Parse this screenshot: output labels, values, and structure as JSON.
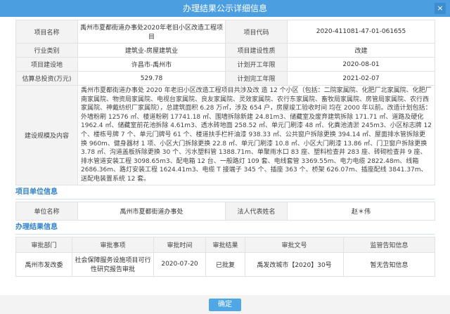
{
  "window": {
    "title": "办理结果公示详细信息",
    "close_glyph": "×"
  },
  "project": {
    "name_label": "项目名称",
    "name_value": "禹州市夏都街道办事处2020年老旧小区改造工程项目",
    "code_label": "项目代码",
    "code_value": "2020-411081-47-01-061655",
    "industry_label": "行业类别",
    "industry_value": "建筑业-房屋建筑业",
    "nature_label": "项目建设性质",
    "nature_value": "改建",
    "location_label": "项目建设地",
    "location_value": "许昌市-禹州市",
    "start_label": "计划开工年限",
    "start_value": "2020-08-01",
    "invest_label": "估算总投资(万元)",
    "invest_value": "529.78",
    "finish_label": "计划完工年限",
    "finish_value": "2021-02-07",
    "scope_label": "建设规模及内容",
    "scope_value": "禹州市夏都街道办事处 2020 年老旧小区改造工程项目共涉及改 造 12 个小区（包括：二院家属院、化肥厂北家属院、化肥厂南家属院、物资局家属院、电视台家属院、良友家属院、灵效家属院、农行东家属院、畜牧局家属院、房管局家属院、农行西家属院、神戴纺织厂家属院），总建筑面积 6.28 万㎡，涉及 654 户，房屋竣工验收时间 均在 2000 年以前。改造计划包括：外墙粉刷 12576 ㎡、楼道粉刷 17741.18 ㎡、围墙拆除新建 24.81m3、储藏室及废弃建筑拆除 171.71 ㎡、道路及硬化 1962.4 ㎡、储藏室前花池拆除 4.61m3、透水砖地面 258.52 ㎡、单元门刷漆 48 ㎡、化粪池清淤 245m3、小区标志牌 12 个、楼栋号牌 7 个、单元门牌号 61 个、楼道扶手栏杆油漆 938.33 ㎡、公共窗户拆除更换 394.14 ㎡、屋面排水管拆除更换 960m、健身器材 1 项、小区大门拆除更换 22.8 ㎡、单元门刷漆 10.8 ㎡、小区大门刷漆 13.86 ㎡、门卫窗户拆除更换 3.78 ㎡、沟道盖板拆除更换 30 个、污水塑料管 1388.71m、单聚雨水口 83 座、塑料检查井 283 座、砖砌检查井 9 座、排水管道安装工程 3098.65m3、配电箱 12 台、一般路灯 109 套、电线套管 3369.55m、电力电缆 2822.48m、线箱 2686.36m、路灯安装工程 1624.41m3、电缆 T 接端子 345 个、插座 363 个、桥架 626.07m、插座配线 3841.37m、送配电装置系统 12 套。"
  },
  "unit_section": {
    "title": "项目单位信息",
    "unit_label": "单位名称",
    "unit_value": "禹州市夏都街道办事处",
    "rep_label": "法人代表姓名",
    "rep_value": "赵＊伟"
  },
  "result_section": {
    "title": "办理结果信息",
    "headers": [
      "审批部门",
      "审批事项",
      "审批时间",
      "审批结果",
      "审批文号",
      "监管告知信息"
    ],
    "row": [
      "禹州市发改委",
      "社会保障服务设施项目可行性研究报告审批",
      "2020-07-20",
      "已批复",
      "禹发改城市【2020】30号",
      "暂无告知信息"
    ]
  },
  "footer": {
    "ok_label": "确定"
  }
}
